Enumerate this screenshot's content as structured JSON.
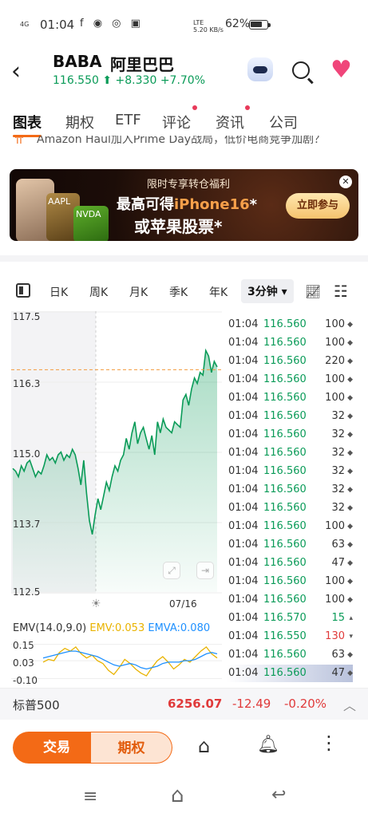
{
  "status": {
    "time": "01:04",
    "signal": "4G",
    "apps": "f ◉ ◎ ▣",
    "net_speed": "5.20",
    "net_unit": "KB/s",
    "lte": "LTE",
    "battery": "62%"
  },
  "header": {
    "ticker": "BABA",
    "company": "阿里巴巴",
    "price": "116.550",
    "arrow": "⬆",
    "change": "+8.330",
    "change_pct": "+7.70%"
  },
  "tabs": [
    {
      "label": "图表",
      "active": true,
      "dot": false
    },
    {
      "label": "期权",
      "active": false,
      "dot": false
    },
    {
      "label": "ETF",
      "active": false,
      "dot": false
    },
    {
      "label": "评论",
      "active": false,
      "dot": true
    },
    {
      "label": "资讯",
      "active": false,
      "dot": true
    },
    {
      "label": "公司",
      "active": false,
      "dot": false
    }
  ],
  "news_ticker": "Amazon Haul加入Prime Day战局，低价电商竞争加剧？",
  "banner": {
    "line1": "限时专享转仓福利",
    "line2_prefix": "最高可得",
    "line2_highlight": "iPhone16",
    "line2_star": "*",
    "line3": "或苹果股票*",
    "cta": "立即参与",
    "tag_aapl": "AAPL",
    "tag_nvda": "NVDA",
    "close": "✕"
  },
  "periods": [
    {
      "label": "日K"
    },
    {
      "label": "周K"
    },
    {
      "label": "月K"
    },
    {
      "label": "季K"
    },
    {
      "label": "年K"
    }
  ],
  "active_period": "3分钟 ▾",
  "chart_data": {
    "type": "area",
    "y_ticks": [
      "117.5",
      "116.3",
      "115.0",
      "113.7",
      "112.5"
    ],
    "ylim": [
      112.5,
      117.5
    ],
    "x_label": "07/16",
    "reference_price": 116.55,
    "values": [
      114.75,
      114.7,
      114.6,
      114.8,
      114.7,
      114.85,
      114.9,
      114.75,
      114.6,
      114.7,
      114.65,
      114.8,
      115.0,
      114.9,
      114.95,
      114.85,
      115.0,
      115.05,
      114.9,
      115.0,
      114.95,
      115.1,
      115.0,
      114.75,
      114.45,
      114.9,
      114.3,
      113.8,
      113.55,
      113.9,
      114.2,
      114.0,
      114.25,
      114.5,
      114.35,
      114.6,
      114.8,
      114.7,
      114.9,
      115.0,
      115.3,
      115.1,
      115.4,
      115.6,
      115.2,
      115.4,
      115.5,
      115.3,
      115.1,
      115.35,
      115.0,
      115.6,
      115.4,
      115.65,
      115.5,
      115.45,
      115.4,
      115.6,
      115.55,
      115.5,
      116.0,
      116.1,
      115.9,
      116.2,
      116.4,
      116.3,
      116.5,
      116.45,
      116.9,
      116.8,
      116.5,
      116.7,
      116.6
    ]
  },
  "trades": [
    {
      "time": "01:04",
      "price": "116.560",
      "vol": "100",
      "mark": "◆",
      "vol_color": ""
    },
    {
      "time": "01:04",
      "price": "116.560",
      "vol": "100",
      "mark": "◆",
      "vol_color": ""
    },
    {
      "time": "01:04",
      "price": "116.560",
      "vol": "220",
      "mark": "◆",
      "vol_color": ""
    },
    {
      "time": "01:04",
      "price": "116.560",
      "vol": "100",
      "mark": "◆",
      "vol_color": ""
    },
    {
      "time": "01:04",
      "price": "116.560",
      "vol": "100",
      "mark": "◆",
      "vol_color": ""
    },
    {
      "time": "01:04",
      "price": "116.560",
      "vol": "32",
      "mark": "◆",
      "vol_color": ""
    },
    {
      "time": "01:04",
      "price": "116.560",
      "vol": "32",
      "mark": "◆",
      "vol_color": ""
    },
    {
      "time": "01:04",
      "price": "116.560",
      "vol": "32",
      "mark": "◆",
      "vol_color": ""
    },
    {
      "time": "01:04",
      "price": "116.560",
      "vol": "32",
      "mark": "◆",
      "vol_color": ""
    },
    {
      "time": "01:04",
      "price": "116.560",
      "vol": "32",
      "mark": "◆",
      "vol_color": ""
    },
    {
      "time": "01:04",
      "price": "116.560",
      "vol": "32",
      "mark": "◆",
      "vol_color": ""
    },
    {
      "time": "01:04",
      "price": "116.560",
      "vol": "100",
      "mark": "◆",
      "vol_color": ""
    },
    {
      "time": "01:04",
      "price": "116.560",
      "vol": "63",
      "mark": "◆",
      "vol_color": ""
    },
    {
      "time": "01:04",
      "price": "116.560",
      "vol": "47",
      "mark": "◆",
      "vol_color": ""
    },
    {
      "time": "01:04",
      "price": "116.560",
      "vol": "100",
      "mark": "◆",
      "vol_color": ""
    },
    {
      "time": "01:04",
      "price": "116.560",
      "vol": "100",
      "mark": "◆",
      "vol_color": ""
    },
    {
      "time": "01:04",
      "price": "116.570",
      "vol": "15",
      "mark": "▴",
      "vol_color": "green"
    },
    {
      "time": "01:04",
      "price": "116.550",
      "vol": "130",
      "mark": "▾",
      "vol_color": "red"
    },
    {
      "time": "01:04",
      "price": "116.560",
      "vol": "63",
      "mark": "◆",
      "vol_color": ""
    },
    {
      "time": "01:04",
      "price": "116.560",
      "vol": "47",
      "mark": "◆",
      "vol_color": ""
    }
  ],
  "indicator": {
    "name": "EMV(14.0,9.0)",
    "emv": "EMV:0.053",
    "emva": "EMVA:0.080",
    "y_ticks": [
      "0.15",
      "0.03",
      "-0.10"
    ],
    "emv_values": [
      0.02,
      0.04,
      0.03,
      0.09,
      0.12,
      0.1,
      0.13,
      0.08,
      0.05,
      0.07,
      0.03,
      0.01,
      -0.04,
      -0.07,
      -0.02,
      0.04,
      0.01,
      -0.03,
      -0.06,
      -0.08,
      -0.02,
      0.03,
      0.06,
      0.02,
      -0.03,
      0.0,
      0.04,
      0.02,
      0.06,
      0.1,
      0.13,
      0.08,
      0.05
    ],
    "emva_values": [
      0.05,
      0.06,
      0.07,
      0.08,
      0.09,
      0.1,
      0.1,
      0.09,
      0.08,
      0.07,
      0.06,
      0.04,
      0.02,
      0.0,
      -0.01,
      0.0,
      0.01,
      0.0,
      -0.02,
      -0.03,
      -0.02,
      -0.01,
      0.01,
      0.02,
      0.02,
      0.02,
      0.03,
      0.03,
      0.04,
      0.06,
      0.08,
      0.09,
      0.08
    ]
  },
  "index_bar": {
    "name": "标普500",
    "value": "6256.07",
    "change": "-12.49",
    "pct": "-0.20%",
    "caret": "︿"
  },
  "actions": {
    "trade": "交易",
    "options": "期权",
    "bank": "⌂",
    "alert": "🔔︎",
    "more": "⋮"
  },
  "nav": {
    "menu": "≡",
    "home": "⌂",
    "back": "↩"
  },
  "colors": {
    "up": "#0a9b58",
    "down": "#e03a3a",
    "accent": "#f36a16",
    "emv": "#e9b300",
    "emva": "#1e90ff"
  }
}
